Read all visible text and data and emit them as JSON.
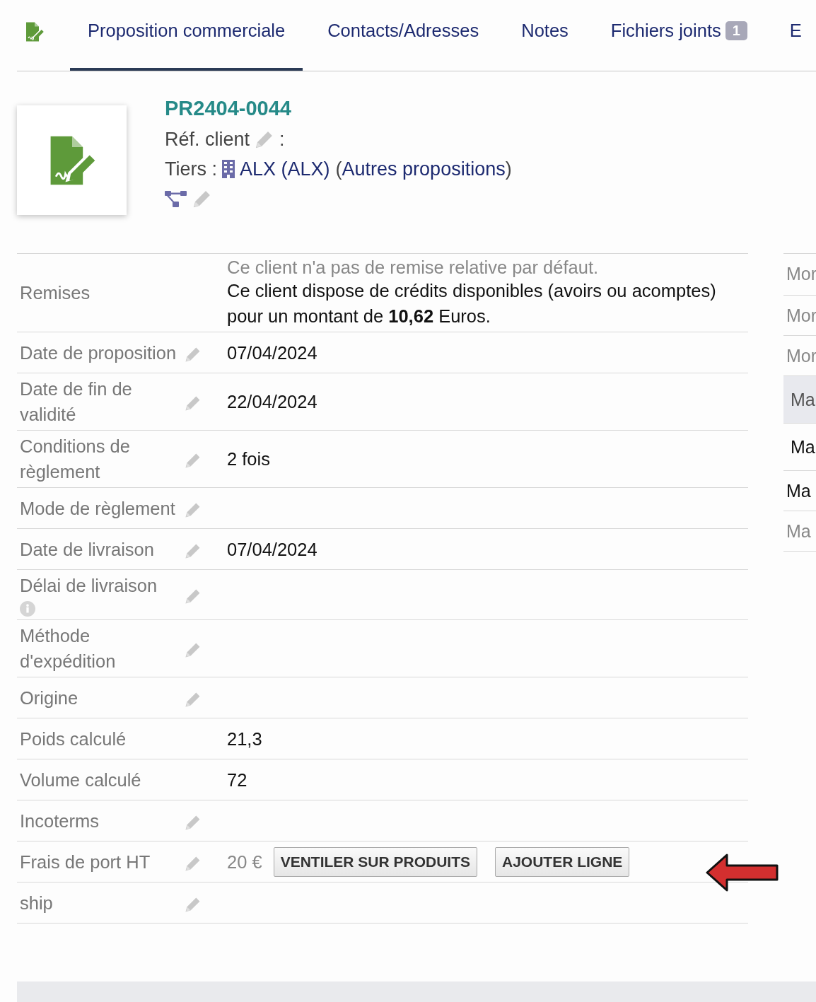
{
  "tabs": [
    {
      "label": "Proposition commerciale",
      "selected": true
    },
    {
      "label": "Contacts/Adresses",
      "selected": false
    },
    {
      "label": "Notes",
      "selected": false
    },
    {
      "label": "Fichiers joints",
      "selected": false,
      "badge": "1"
    },
    {
      "label": "E",
      "selected": false
    }
  ],
  "header": {
    "ref": "PR2404-0044",
    "ref_client_label": "Réf. client",
    "ref_client_sep": ":",
    "tiers_label": "Tiers :",
    "tiers_name": "ALX (ALX)",
    "paren_open": "(",
    "other_link": "Autres propositions",
    "paren_close": ")"
  },
  "fields": [
    {
      "kind": "remises",
      "label": "Remises",
      "editable": false,
      "lines": [
        {
          "text": "Ce client n'a pas de remise relative par défaut.",
          "muted": true
        },
        {
          "text": "Ce client dispose de crédits disponibles (avoirs ou acomptes) pour un montant de **10,62** Euros.",
          "muted": false
        }
      ]
    },
    {
      "kind": "text",
      "label": "Date de proposition",
      "editable": true,
      "value": "07/04/2024"
    },
    {
      "kind": "text",
      "label": "Date de fin de validité",
      "editable": true,
      "value": "22/04/2024"
    },
    {
      "kind": "text",
      "label": "Conditions de règlement",
      "editable": true,
      "value": "2 fois"
    },
    {
      "kind": "text",
      "label": "Mode de règlement",
      "editable": true
    },
    {
      "kind": "text",
      "label": "Date de livraison",
      "editable": true,
      "value": "07/04/2024"
    },
    {
      "kind": "text",
      "label": "Délai de livraison",
      "editable": true,
      "info": true
    },
    {
      "kind": "text",
      "label": "Méthode d'expédition",
      "editable": true
    },
    {
      "kind": "text",
      "label": "Origine",
      "editable": true
    },
    {
      "kind": "text",
      "label": "Poids calculé",
      "editable": false,
      "value": "21,3"
    },
    {
      "kind": "text",
      "label": "Volume calculé",
      "editable": false,
      "value": "72"
    },
    {
      "kind": "text",
      "label": "Incoterms",
      "editable": true
    },
    {
      "kind": "shipping",
      "label": "Frais de port HT",
      "editable": true,
      "value": "20 €",
      "buttons": [
        "VENTILER SUR PRODUITS",
        "AJOUTER LIGNE"
      ]
    },
    {
      "kind": "text",
      "label": "ship",
      "editable": true
    }
  ],
  "side": [
    {
      "kind": "muted",
      "text": "Mor"
    },
    {
      "kind": "muted",
      "text": "Mor"
    },
    {
      "kind": "muted",
      "text": "Mor"
    },
    {
      "kind": "header",
      "text": "Ma"
    },
    {
      "kind": "strong",
      "text": "Ma"
    },
    {
      "kind": "strong",
      "text": "Ma"
    },
    {
      "kind": "muted",
      "text": "Ma"
    }
  ]
}
